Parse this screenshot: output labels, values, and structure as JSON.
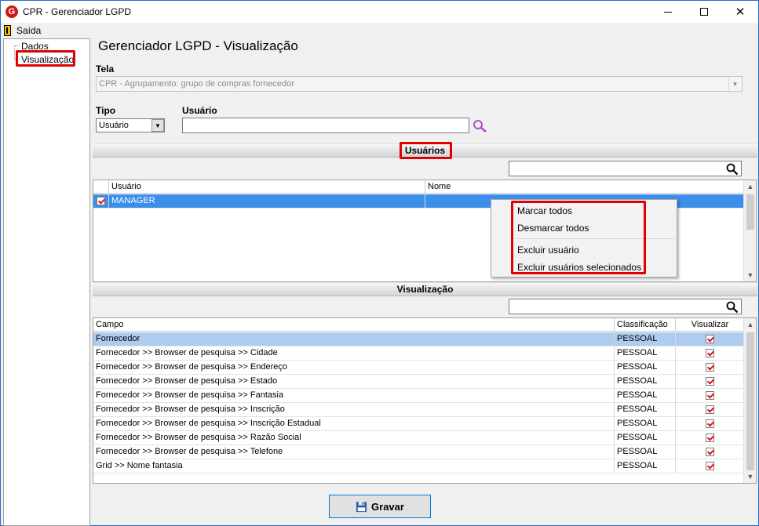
{
  "window": {
    "title": "CPR - Gerenciador LGPD",
    "app_icon_letter": "G",
    "controls": [
      "minimize-icon",
      "maximize-icon",
      "close-icon"
    ]
  },
  "menu": {
    "exit_label": "Saída"
  },
  "tree": {
    "items": [
      {
        "label": "Dados"
      },
      {
        "label": "Visualização"
      }
    ]
  },
  "main": {
    "title": "Gerenciador LGPD - Visualização",
    "tela_label": "Tela",
    "tela_value": "CPR - Agrupamento: grupo de compras fornecedor",
    "tipo_label": "Tipo",
    "tipo_value": "Usuário",
    "usuario_label": "Usuário",
    "usuario_value": ""
  },
  "users_section": {
    "title": "Usuários",
    "search_value": "",
    "columns": [
      "Usuário",
      "Nome"
    ],
    "rows": [
      {
        "checked": true,
        "usuario": "MANAGER",
        "nome": ""
      }
    ]
  },
  "context_menu": {
    "items": [
      "Marcar todos",
      "Desmarcar todos",
      "Excluir usuário",
      "Excluir usuários selecionados"
    ]
  },
  "view_section": {
    "title": "Visualização",
    "search_value": "",
    "columns": [
      "Campo",
      "Classificação",
      "Visualizar"
    ],
    "rows": [
      {
        "campo": "Fornecedor",
        "classificacao": "PESSOAL",
        "visualizar": true
      },
      {
        "campo": "Fornecedor >> Browser de pesquisa >> Cidade",
        "classificacao": "PESSOAL",
        "visualizar": true
      },
      {
        "campo": "Fornecedor >> Browser de pesquisa >> Endereço",
        "classificacao": "PESSOAL",
        "visualizar": true
      },
      {
        "campo": "Fornecedor >> Browser de pesquisa >> Estado",
        "classificacao": "PESSOAL",
        "visualizar": true
      },
      {
        "campo": "Fornecedor >> Browser de pesquisa >> Fantasia",
        "classificacao": "PESSOAL",
        "visualizar": true
      },
      {
        "campo": "Fornecedor >> Browser de pesquisa >> Inscrição",
        "classificacao": "PESSOAL",
        "visualizar": true
      },
      {
        "campo": "Fornecedor >> Browser de pesquisa >> Inscrição Estadual",
        "classificacao": "PESSOAL",
        "visualizar": true
      },
      {
        "campo": "Fornecedor >> Browser de pesquisa >> Razão Social",
        "classificacao": "PESSOAL",
        "visualizar": true
      },
      {
        "campo": "Fornecedor >> Browser de pesquisa >> Telefone",
        "classificacao": "PESSOAL",
        "visualizar": true
      },
      {
        "campo": "Grid >> Nome fantasia",
        "classificacao": "PESSOAL",
        "visualizar": true
      }
    ]
  },
  "footer": {
    "save_label": "Gravar"
  },
  "colors": {
    "selection": "#3b8eea",
    "highlight_box": "#e00000",
    "accent": "#0078d7"
  }
}
